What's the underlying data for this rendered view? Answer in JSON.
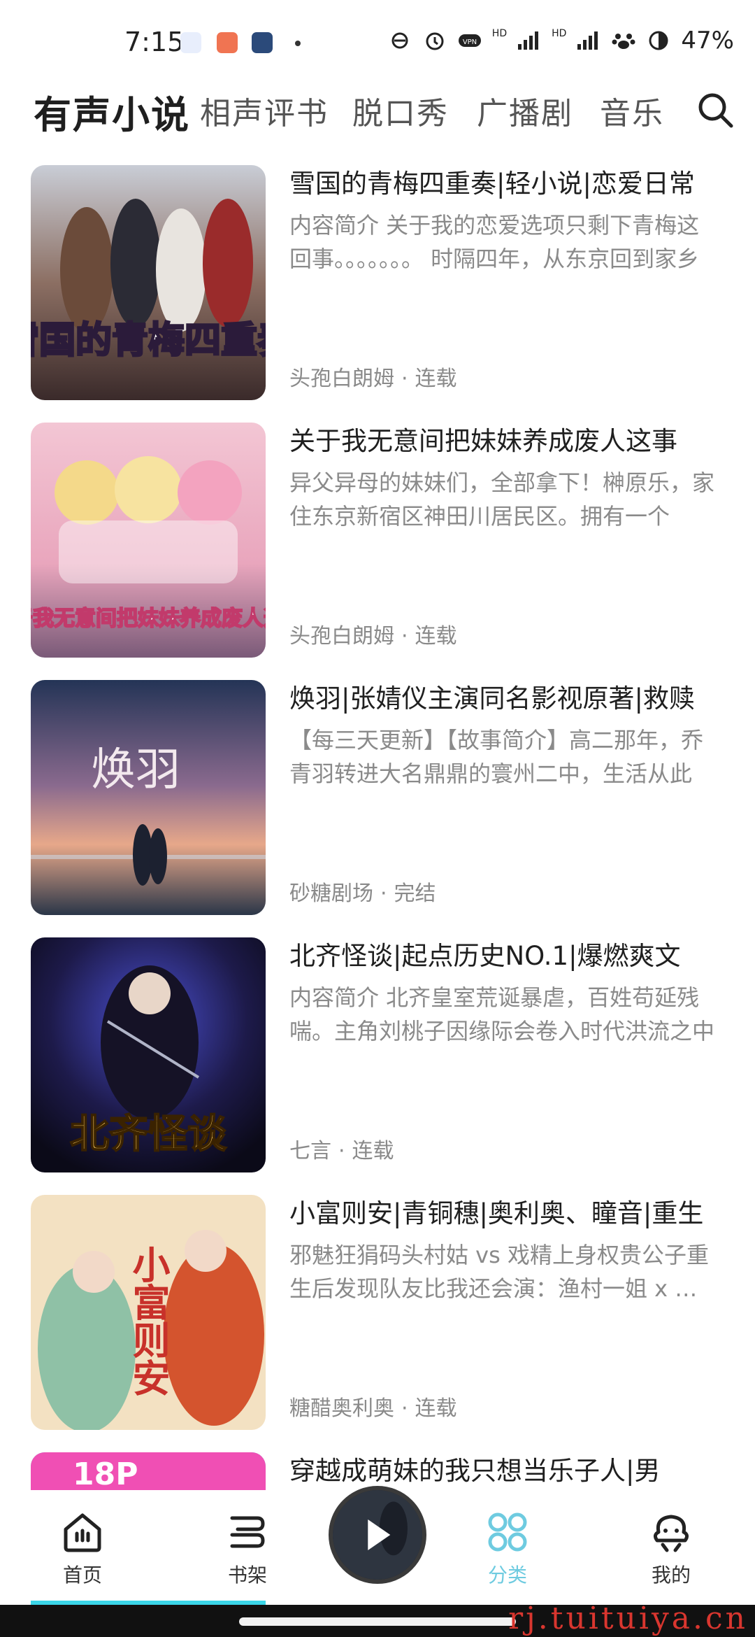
{
  "status_bar": {
    "time": "7:15",
    "network_labels": [
      "HD",
      "HD"
    ],
    "battery": "47%"
  },
  "top_nav": {
    "tabs": [
      {
        "label": "有声小说",
        "active": true
      },
      {
        "label": "相声评书",
        "active": false
      },
      {
        "label": "脱口秀",
        "active": false
      },
      {
        "label": "广播剧",
        "active": false
      },
      {
        "label": "音乐",
        "active": false
      }
    ],
    "search_icon": "search-icon"
  },
  "books": [
    {
      "title": "雪国的青梅四重奏|轻小说|恋爱日常",
      "description": "内容简介 关于我的恋爱选项只剩下青梅这回事。。。。。。。 时隔四年，从东京回到家乡",
      "author": "头孢白朗姆",
      "status": "连载",
      "cover_text": "雪国的青梅四重奏"
    },
    {
      "title": "关于我无意间把妹妹养成废人这事",
      "description": "异父异母的妹妹们，全部拿下！榊原乐，家住东京新宿区神田川居民区。拥有一个",
      "author": "头孢白朗姆",
      "status": "连载",
      "cover_text": "关于我无意间把妹妹养成废人这事"
    },
    {
      "title": "焕羽|张婧仪主演同名影视原著|救赎",
      "description": "【每三天更新】【故事简介】高二那年，乔青羽转进大名鼎鼎的寰州二中，生活从此",
      "author": "砂糖剧场",
      "status": "完结",
      "cover_text": "焕羽"
    },
    {
      "title": "北齐怪谈|起点历史NO.1|爆燃爽文",
      "description": "内容简介 北齐皇室荒诞暴虐，百姓苟延残喘。主角刘桃子因缘际会卷入时代洪流之中",
      "author": "七言",
      "status": "连载",
      "cover_text": "北齐怪谈"
    },
    {
      "title": "小富则安|青铜穗|奥利奥、瞳音|重生",
      "description": "邪魅狂狷码头村姑 vs 戏精上身权贵公子重生后发现队友比我还会演：渔村一姐 x 京城",
      "author": "糖醋奥利奥",
      "status": "连载",
      "cover_text": "小富则安"
    },
    {
      "title": "穿越成萌妹的我只想当乐子人|男",
      "description": "",
      "author": "",
      "status": "",
      "cover_text": "18P"
    }
  ],
  "meta_separator": "·",
  "bottom_nav": {
    "items": [
      {
        "label": "首页",
        "icon": "home-icon",
        "active": false
      },
      {
        "label": "书架",
        "icon": "bookshelf-icon",
        "active": false
      },
      {
        "label": "分类",
        "icon": "category-icon",
        "active": true
      },
      {
        "label": "我的",
        "icon": "profile-icon",
        "active": false
      }
    ],
    "player_icon": "play-icon"
  },
  "watermark": "rj.tuituiya.cn",
  "colors": {
    "accent": "#6ecbe0",
    "text_primary": "#1f1f1f",
    "text_secondary": "#8a8a8a"
  }
}
